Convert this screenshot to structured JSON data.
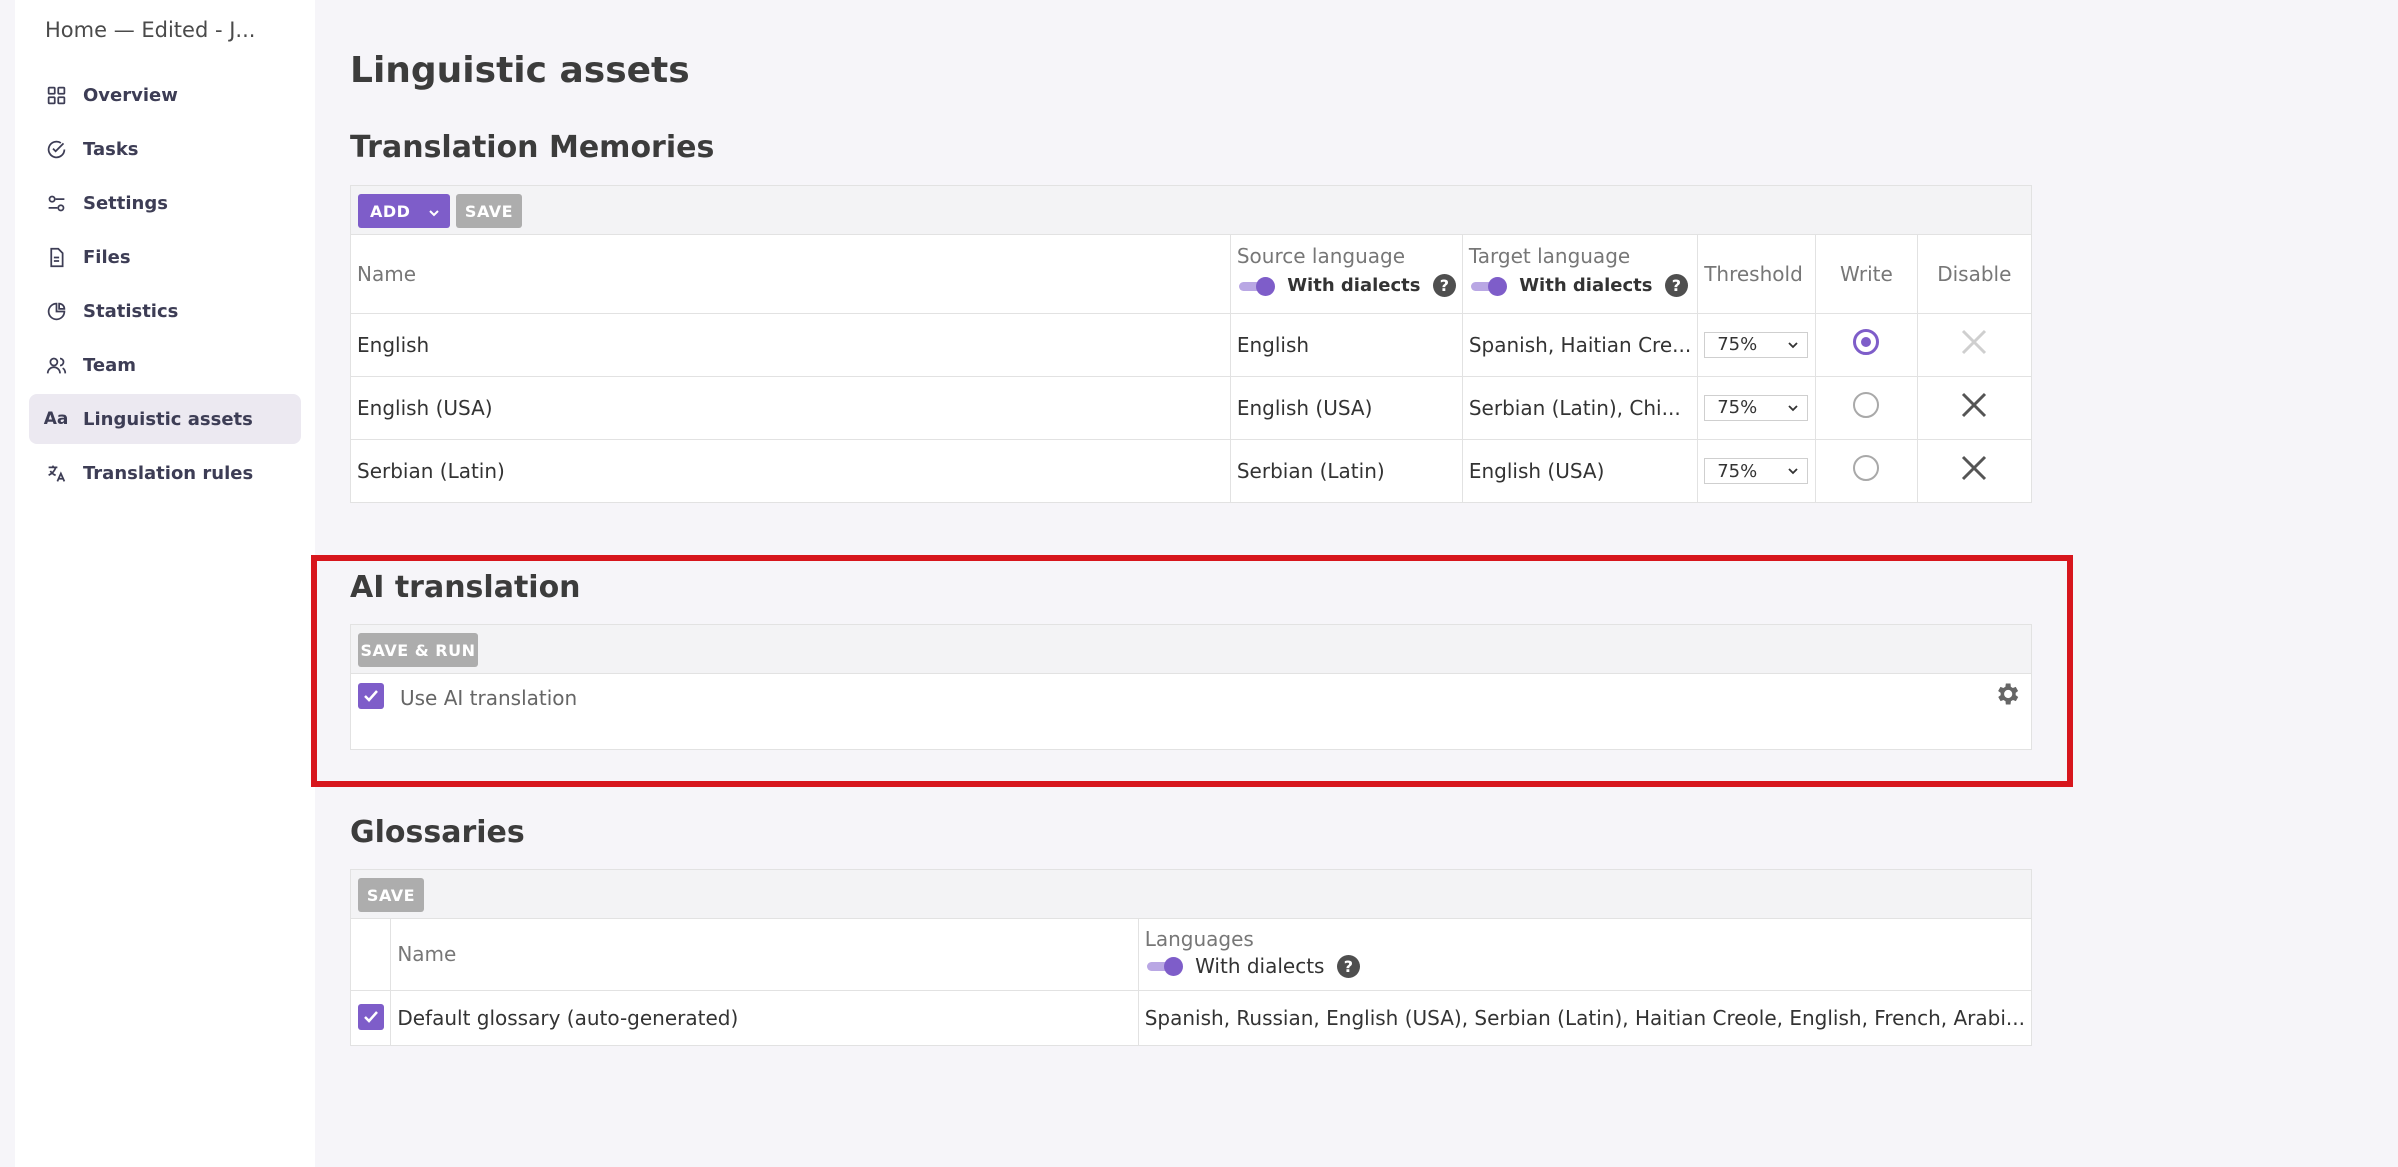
{
  "app": {
    "title": "Home — Edited - J..."
  },
  "sidebar": {
    "items": [
      {
        "label": "Overview",
        "icon": "grid-icon",
        "active": false
      },
      {
        "label": "Tasks",
        "icon": "check-circle-icon",
        "active": false
      },
      {
        "label": "Settings",
        "icon": "sliders-icon",
        "active": false
      },
      {
        "label": "Files",
        "icon": "file-icon",
        "active": false
      },
      {
        "label": "Statistics",
        "icon": "pie-chart-icon",
        "active": false
      },
      {
        "label": "Team",
        "icon": "users-icon",
        "active": false
      },
      {
        "label": "Linguistic assets",
        "icon": "text-aa-icon",
        "active": true
      },
      {
        "label": "Translation rules",
        "icon": "translate-icon",
        "active": false
      }
    ]
  },
  "page": {
    "title": "Linguistic assets"
  },
  "tm": {
    "title": "Translation Memories",
    "add_label": "ADD",
    "save_label": "SAVE",
    "columns": {
      "name": "Name",
      "source": "Source language",
      "target": "Target language",
      "threshold": "Threshold",
      "write": "Write",
      "disable": "Disable",
      "with_dialects": "With dialects",
      "help": "?"
    },
    "rows": [
      {
        "name": "English",
        "source": "English",
        "target": "Spanish, Haitian Cre...",
        "threshold": "75%",
        "write": true,
        "disabled_state": "inactive"
      },
      {
        "name": "English (USA)",
        "source": "English (USA)",
        "target": "Serbian (Latin), Chi...",
        "threshold": "75%",
        "write": false,
        "disabled_state": "active"
      },
      {
        "name": "Serbian (Latin)",
        "source": "Serbian (Latin)",
        "target": "English (USA)",
        "threshold": "75%",
        "write": false,
        "disabled_state": "active"
      }
    ]
  },
  "ai": {
    "title": "AI translation",
    "save_run_label": "SAVE & RUN",
    "use_label": "Use AI translation",
    "use_checked": true
  },
  "glossaries": {
    "title": "Glossaries",
    "save_label": "SAVE",
    "columns": {
      "name": "Name",
      "languages": "Languages",
      "with_dialects": "With dialects",
      "help": "?"
    },
    "rows": [
      {
        "checked": true,
        "name": "Default glossary (auto-generated)",
        "languages": "Spanish, Russian, English (USA), Serbian (Latin), Haitian Creole, English, French, Arabi..."
      }
    ]
  },
  "colors": {
    "accent": "#7e5dc9",
    "highlight": "#d7161d",
    "button_disabled": "#adadad"
  }
}
